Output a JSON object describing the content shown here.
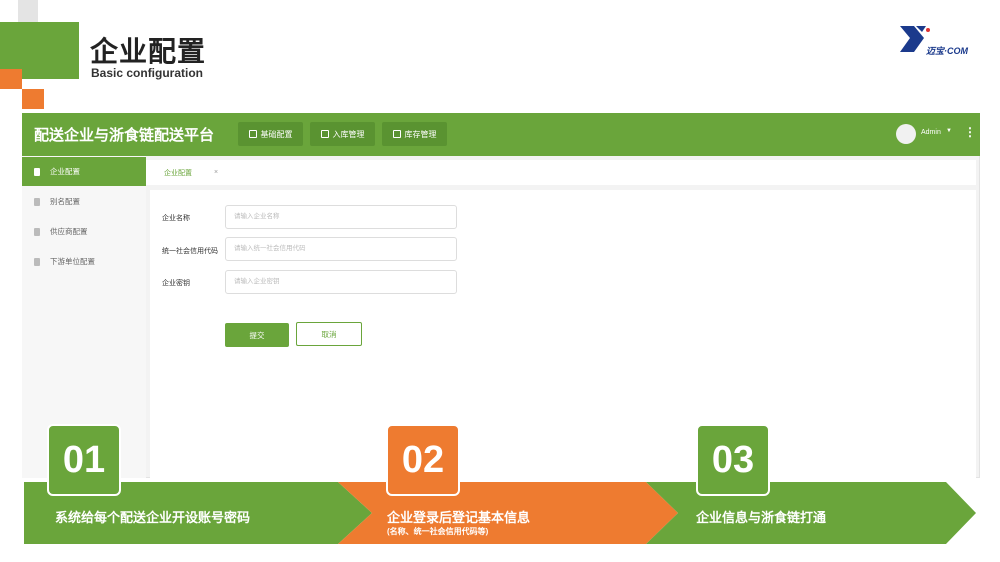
{
  "slide": {
    "title": "企业配置",
    "subtitle": "Basic configuration",
    "logo_text": "迈宝·COM"
  },
  "app": {
    "title": "配送企业与浙食链配送平台",
    "nav": [
      "基础配置",
      "入库管理",
      "库存管理"
    ],
    "user": "Admin",
    "caret": "▼",
    "kebab": "⋮"
  },
  "sidebar": {
    "items": [
      {
        "label": "企业配置",
        "active": true
      },
      {
        "label": "别名配置",
        "active": false
      },
      {
        "label": "供应商配置",
        "active": false
      },
      {
        "label": "下游单位配置",
        "active": false
      }
    ]
  },
  "tabs": [
    {
      "label": "企业配置",
      "close": "×"
    }
  ],
  "form": {
    "fields": [
      {
        "label": "企业名称",
        "placeholder": "请输入企业名称"
      },
      {
        "label": "统一社会信用代码",
        "placeholder": "请输入统一社会信用代码"
      },
      {
        "label": "企业密钥",
        "placeholder": "请输入企业密钥"
      }
    ],
    "submit": "提交",
    "cancel": "取消"
  },
  "process": {
    "steps": [
      {
        "number": "01",
        "text": "系统给每个配送企业开设账号密码",
        "sub": "",
        "color": "#6aa53b"
      },
      {
        "number": "02",
        "text": "企业登录后登记基本信息",
        "sub": "(名称、统一社会信用代码等)",
        "color": "#ee7b30"
      },
      {
        "number": "03",
        "text": "企业信息与浙食链打通",
        "sub": "",
        "color": "#6aa53b"
      }
    ]
  },
  "colors": {
    "green": "#6aa53b",
    "orange": "#ee7b30",
    "logo_blue": "#1b3a8c"
  }
}
